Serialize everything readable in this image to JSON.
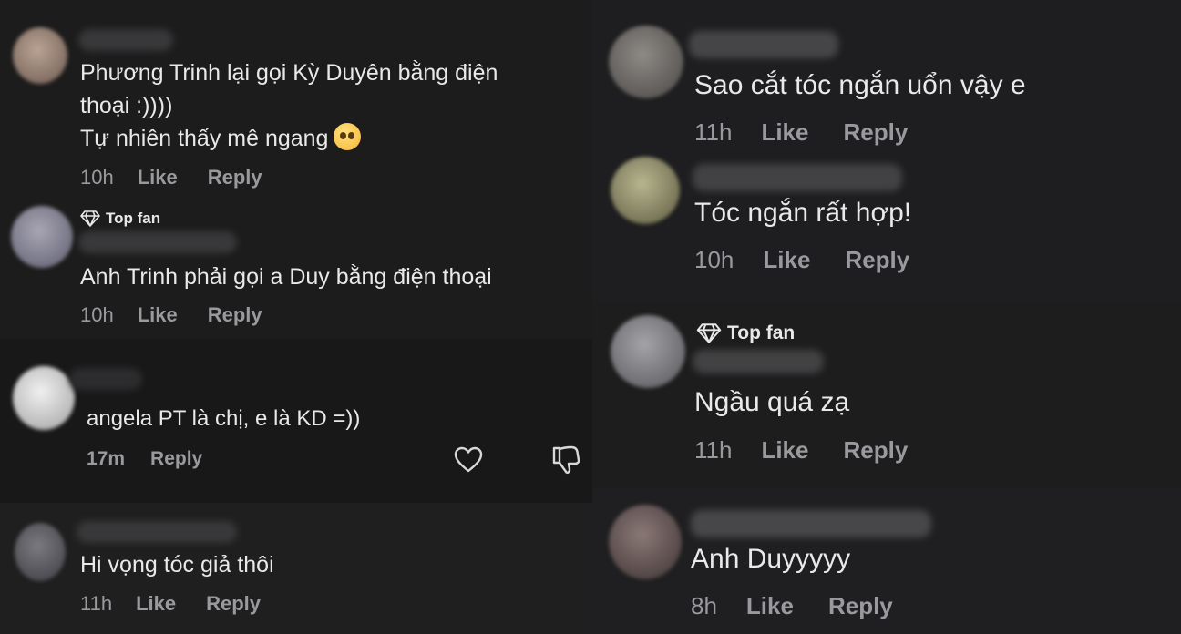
{
  "left": {
    "c1": {
      "lines": [
        "Phương Trinh lại gọi Kỳ Duyên bằng điện",
        "thoại :))))",
        "Tự nhiên thấy mê ngang"
      ],
      "emoji": "pleading-face-emoji",
      "time": "10h",
      "like": "Like",
      "reply": "Reply"
    },
    "c2": {
      "badge": "Top fan",
      "text": "Anh Trinh phải gọi a Duy bằng điện thoại",
      "time": "10h",
      "like": "Like",
      "reply": "Reply"
    },
    "c3": {
      "text": "angela PT là chị, e là KD =))",
      "time": "17m",
      "reply": "Reply",
      "icons": [
        "heart-icon",
        "dislike-icon"
      ]
    },
    "c4": {
      "text": "Hi vọng tóc giả thôi",
      "time": "11h",
      "like": "Like",
      "reply": "Reply"
    }
  },
  "right": {
    "c1": {
      "text": "Sao cắt tóc ngắn uổn vậy e",
      "time": "11h",
      "like": "Like",
      "reply": "Reply"
    },
    "c2": {
      "text": "Tóc ngắn rất hợp!",
      "time": "10h",
      "like": "Like",
      "reply": "Reply"
    },
    "c3": {
      "badge": "Top fan",
      "text": "Ngầu quá zạ",
      "time": "11h",
      "like": "Like",
      "reply": "Reply"
    },
    "c4": {
      "text": "Anh Duyyyyy",
      "time": "8h",
      "like": "Like",
      "reply": "Reply"
    }
  }
}
